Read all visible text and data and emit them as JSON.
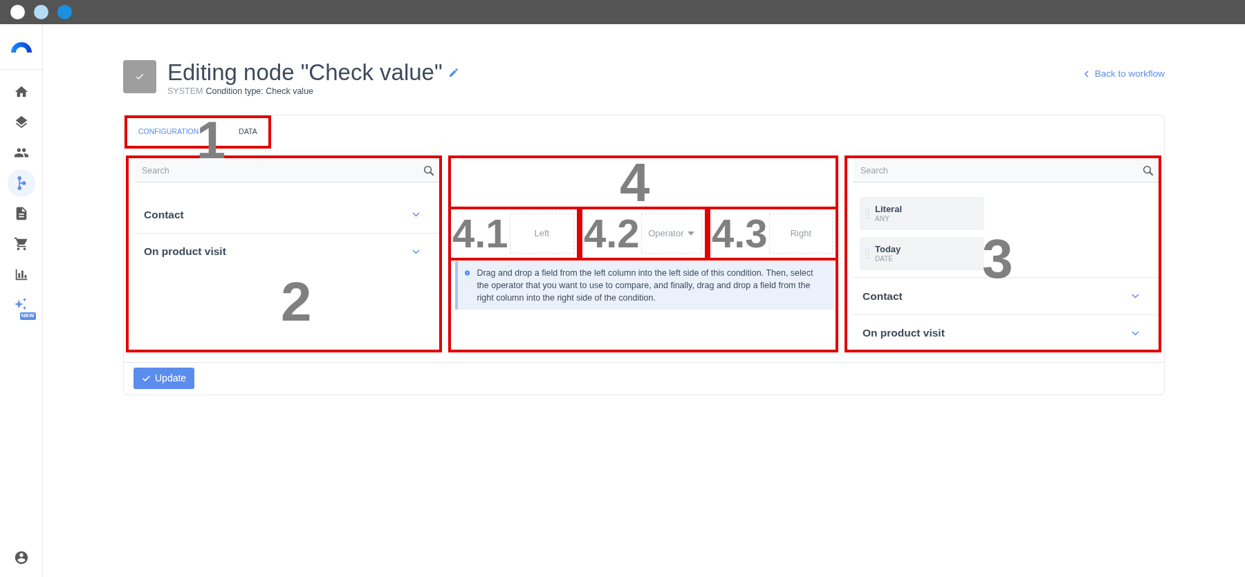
{
  "sidebar": {
    "items": [
      {
        "selected": false
      },
      {
        "selected": false
      },
      {
        "selected": false
      },
      {
        "selected": true
      },
      {
        "selected": false
      },
      {
        "selected": false
      },
      {
        "selected": false
      },
      {
        "selected": false,
        "badge": "NEW"
      }
    ]
  },
  "header": {
    "title": "Editing node \"Check value\"",
    "system_label": "SYSTEM",
    "subtitle": "Condition type: Check value",
    "back_link": "Back to workflow"
  },
  "tabs": {
    "callout": "1",
    "items": [
      {
        "label": "CONFIGURATION",
        "selected": true
      },
      {
        "label": "DATA",
        "selected": false
      }
    ]
  },
  "left_column": {
    "callout": "2",
    "search": {
      "placeholder": "Search"
    },
    "groups": [
      {
        "label": "Contact",
        "expanded": false
      },
      {
        "label": "On product visit",
        "expanded": false
      }
    ]
  },
  "condition": {
    "callout": "4",
    "sides": [
      {
        "kind": "field",
        "label": "Left",
        "callout": "4.1"
      },
      {
        "kind": "select",
        "label": "Operator",
        "callout": "4.2"
      },
      {
        "kind": "field",
        "label": "Right",
        "callout": "4.3"
      }
    ],
    "info": "Drag and drop a field from the left column into the left side of this condition. Then, select the operator that you want to use to compare, and finally, drag and drop a field from the right column into the right side of the condition."
  },
  "right_column": {
    "callout": "3",
    "search": {
      "placeholder": "Search"
    },
    "constants": [
      {
        "name": "Literal",
        "type": "ANY"
      },
      {
        "name": "Today",
        "type": "DATE"
      }
    ],
    "groups": [
      {
        "label": "Contact",
        "expanded": false
      },
      {
        "label": "On product visit",
        "expanded": false
      }
    ]
  },
  "footer": {
    "button": "Update"
  }
}
